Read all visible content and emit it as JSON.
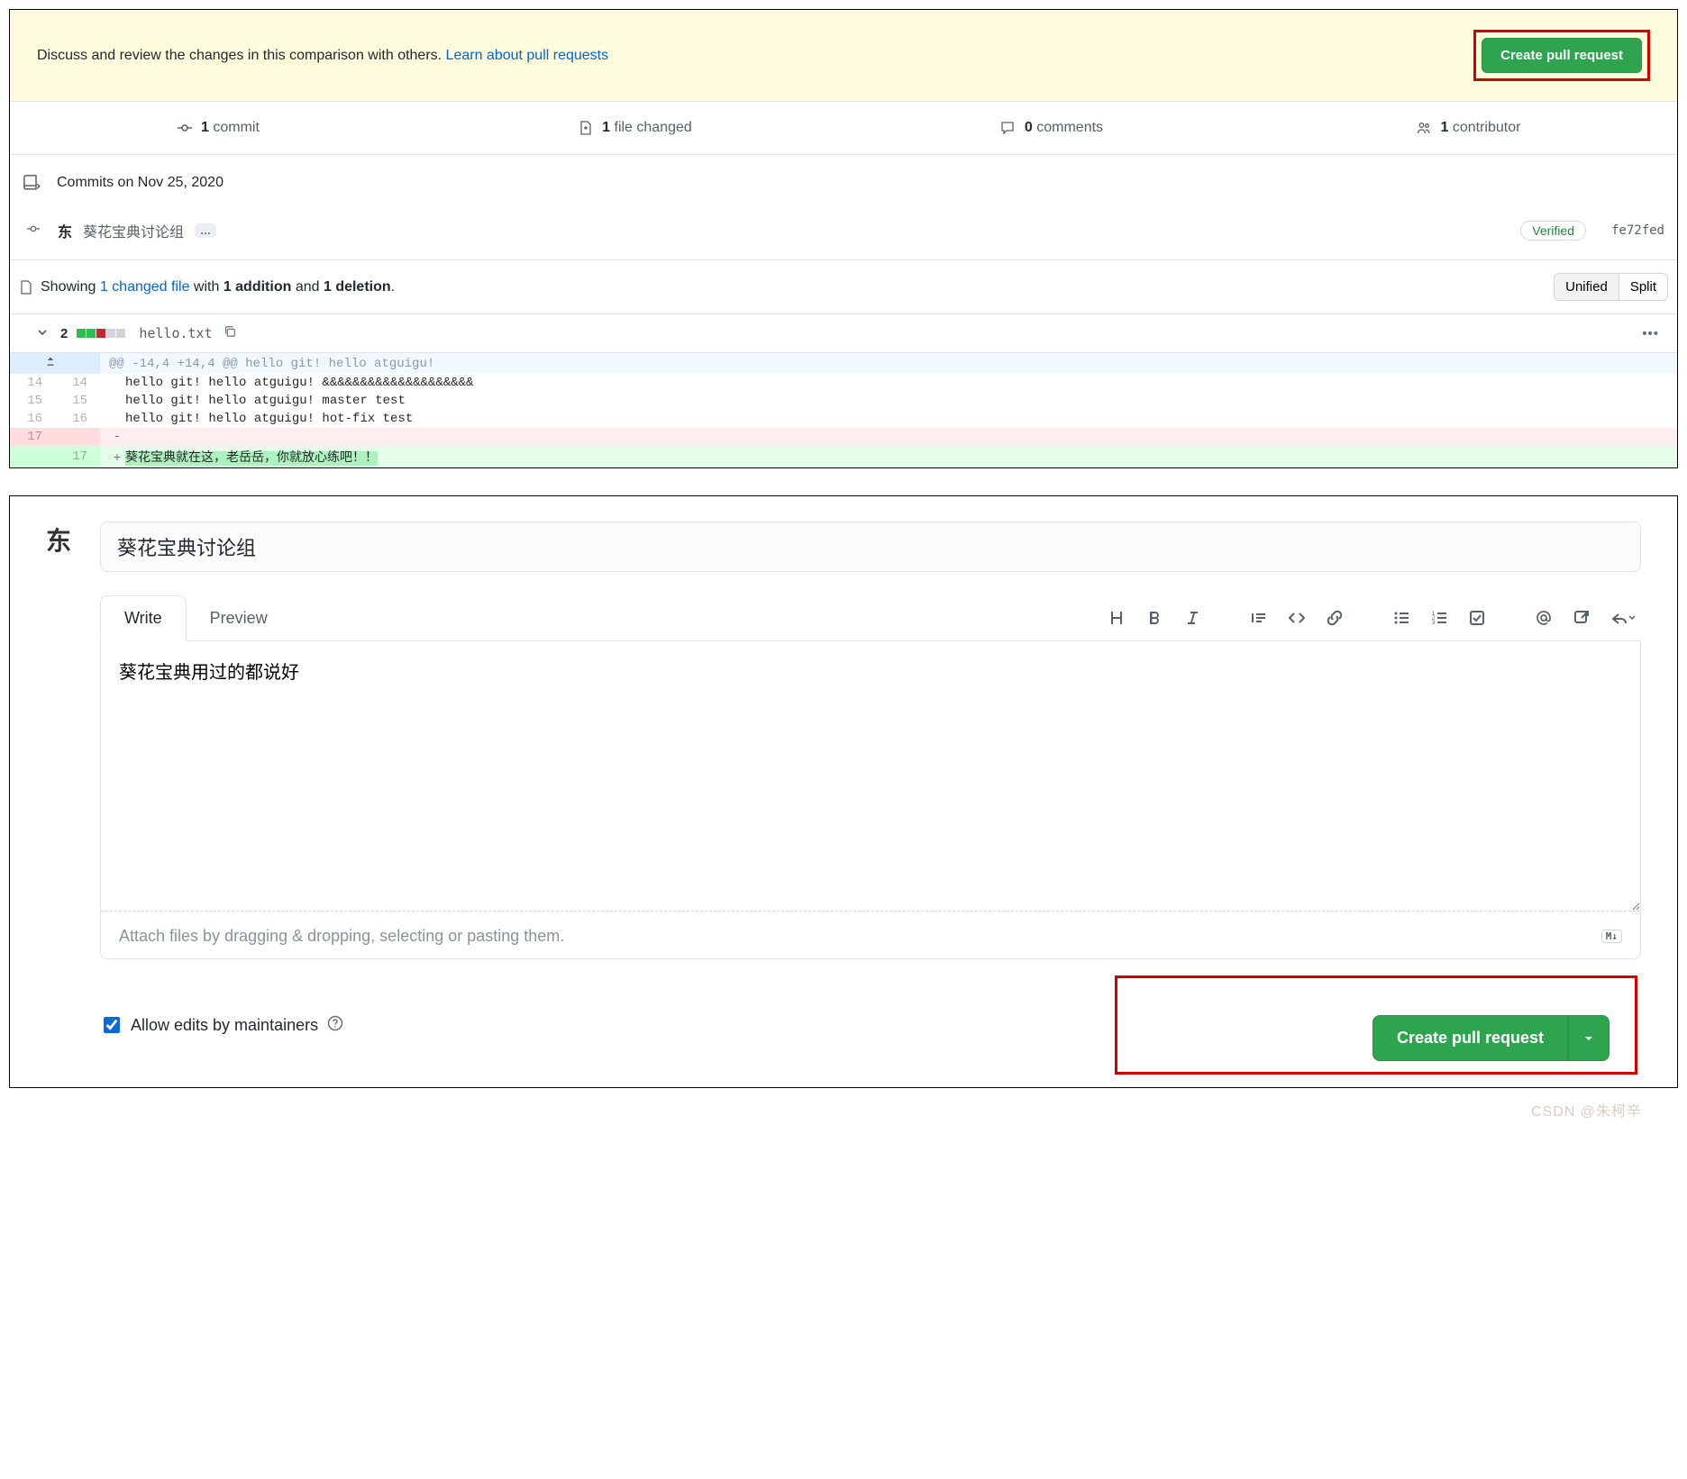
{
  "banner": {
    "text_prefix": "Discuss and review the changes in this comparison with others. ",
    "link_text": "Learn about pull requests",
    "button_label": "Create pull request"
  },
  "counts": {
    "commit": {
      "n": "1",
      "label": "commit"
    },
    "file_changed": {
      "n": "1",
      "label": "file changed"
    },
    "comments": {
      "n": "0",
      "label": "comments"
    },
    "contributor": {
      "n": "1",
      "label": "contributor"
    }
  },
  "commits": {
    "heading": "Commits on Nov 25, 2020",
    "row": {
      "avatar_char": "东",
      "message": "葵花宝典讨论组",
      "more": "…",
      "verified": "Verified",
      "hash": "fe72fed"
    }
  },
  "diff_summary": {
    "showing_word": "Showing ",
    "link": "1 changed file",
    "mid1": " with ",
    "add_bold": "1 addition",
    "mid2": " and ",
    "del_bold": "1 deletion",
    "tail": ".",
    "view_unified": "Unified",
    "view_split": "Split"
  },
  "file": {
    "change_count": "2",
    "name": "hello.txt",
    "kebab": "•••"
  },
  "diff_lines": {
    "hunk": "@@ -14,4 +14,4 @@ hello git! hello atguigu!",
    "l14": "hello git! hello atguigu! &&&&&&&&&&&&&&&&&&&&",
    "l15": "hello git! hello atguigu! master test",
    "l16": "hello git! hello atguigu! hot-fix test",
    "del": "",
    "add": "葵花宝典就在这，老岳岳，你就放心练吧！！",
    "nums": {
      "ctx14_old": "14",
      "ctx14_new": "14",
      "ctx15_old": "15",
      "ctx15_new": "15",
      "ctx16_old": "16",
      "ctx16_new": "16",
      "del_old": "17",
      "add_new": "17"
    }
  },
  "editor": {
    "avatar_char": "东",
    "title_value": "葵花宝典讨论组",
    "tab_write": "Write",
    "tab_preview": "Preview",
    "body_value": "葵花宝典用过的都说好",
    "attach_hint": "Attach files by dragging & dropping, selecting or pasting them.",
    "md_badge": "M↓",
    "allow_label": "Allow edits by maintainers",
    "submit_label": "Create pull request"
  },
  "watermark": "CSDN @朱柯辛"
}
